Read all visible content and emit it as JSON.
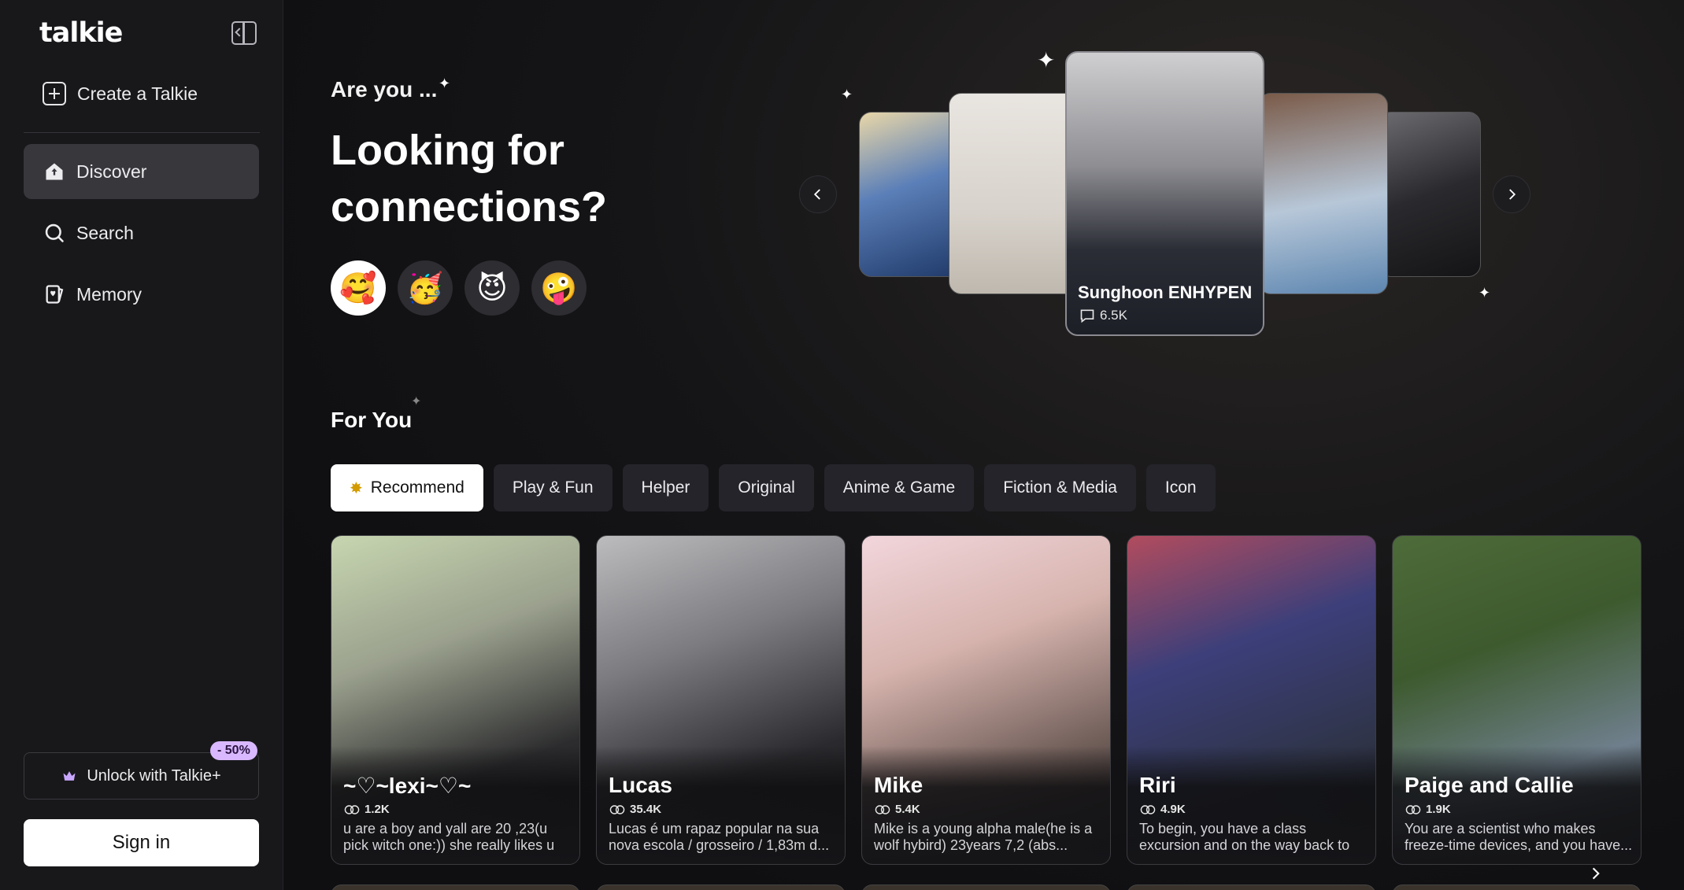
{
  "app": {
    "logo": "talkie"
  },
  "sidebar": {
    "create_label": "Create a Talkie",
    "nav": [
      {
        "label": "Discover",
        "icon": "home-icon",
        "active": true
      },
      {
        "label": "Search",
        "icon": "search-icon",
        "active": false
      },
      {
        "label": "Memory",
        "icon": "memory-card-icon",
        "active": false
      }
    ],
    "unlock_label": "Unlock with Talkie+",
    "discount_badge": "- 50%",
    "signin_label": "Sign in"
  },
  "hero": {
    "subtitle": "Are you ...",
    "title": "Looking for connections?",
    "emojis": [
      "🥰",
      "🥳",
      "😈",
      "🤪"
    ],
    "featured": {
      "name": "Sunghoon ENHYPEN",
      "count": "6.5K"
    }
  },
  "for_you": {
    "title": "For You",
    "tabs": [
      "Recommend",
      "Play & Fun",
      "Helper",
      "Original",
      "Anime & Game",
      "Fiction & Media",
      "Icon"
    ],
    "cards": [
      {
        "name": "~♡~lexi~♡~",
        "count": "1.2K",
        "desc": "u are a boy and yall are 20 ,23(u pick witch one:)) she really likes u"
      },
      {
        "name": "Lucas",
        "count": "35.4K",
        "desc": "Lucas é um rapaz popular na sua nova escola / grosseiro / 1,83m d..."
      },
      {
        "name": "Mike",
        "count": "5.4K",
        "desc": "Mike is a young alpha male(he is a wolf hybird) 23years 7,2 (abs..."
      },
      {
        "name": "Riri",
        "count": "4.9K",
        "desc": "To begin, you have a class excursion and on the way back to school,..."
      },
      {
        "name": "Paige and Callie",
        "count": "1.9K",
        "desc": "You are a scientist who makes freeze-time devices, and you have..."
      }
    ]
  },
  "colors": {
    "background": "#0f0f11",
    "sidebar": "#18181b",
    "active_nav": "#37373c",
    "badge": "#d9b8ff"
  }
}
